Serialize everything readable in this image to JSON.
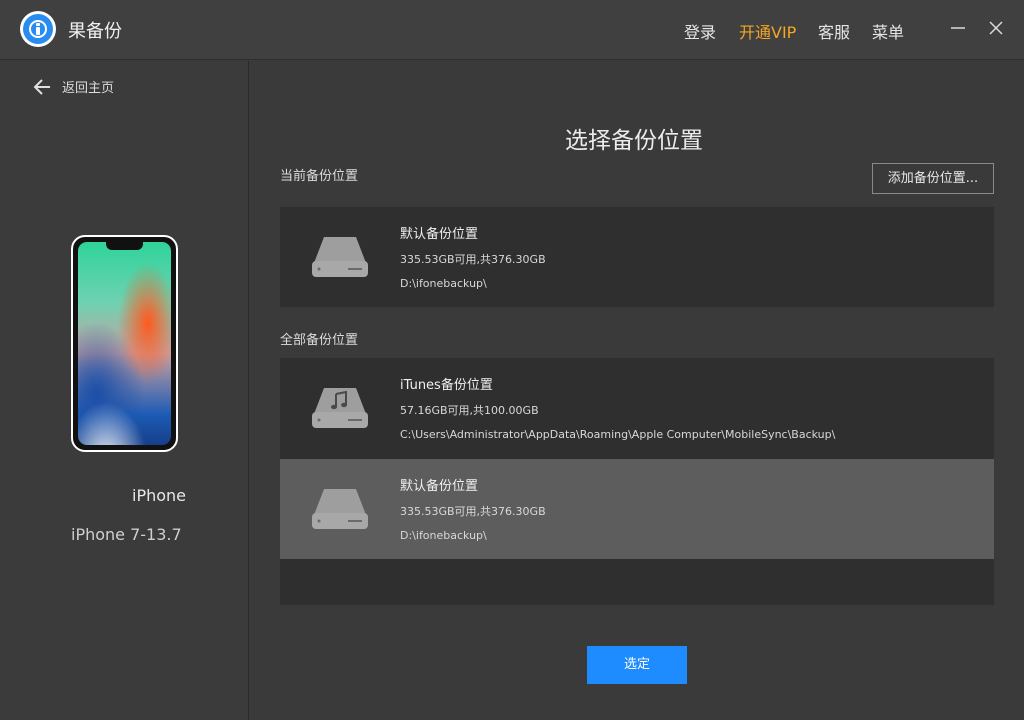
{
  "app": {
    "title": "果备份",
    "logo_icon": "info-refresh-icon"
  },
  "header": {
    "menu": [
      {
        "label": "登录"
      },
      {
        "label": "开通VIP",
        "color": "#f5a623"
      },
      {
        "label": "客服"
      },
      {
        "label": "菜单"
      }
    ],
    "minimize_icon": "minimize-icon",
    "close_icon": "close-icon"
  },
  "sidebar": {
    "back_label": "返回主页",
    "back_icon": "arrow-left-icon",
    "device_name": "iPhone",
    "device_model": "iPhone 7-13.7"
  },
  "main": {
    "title": "选择备份位置",
    "current_label": "当前备份位置",
    "add_button": "添加备份位置...",
    "current": {
      "name": "默认备份位置",
      "size": "335.53GB可用,共376.30GB",
      "path": "D:\\ifonebackup\\",
      "icon": "drive-icon"
    },
    "all_label": "全部备份位置",
    "all": [
      {
        "name": "iTunes备份位置",
        "size": "57.16GB可用,共100.00GB",
        "path": "C:\\Users\\Administrator\\AppData\\Roaming\\Apple Computer\\MobileSync\\Backup\\",
        "icon": "music-drive-icon",
        "selected": false
      },
      {
        "name": "默认备份位置",
        "size": "335.53GB可用,共376.30GB",
        "path": "D:\\ifonebackup\\",
        "icon": "drive-icon",
        "selected": true
      }
    ],
    "confirm_button": "选定"
  },
  "colors": {
    "accent": "#1e8bff",
    "vip": "#f5a623",
    "selected_row": "#5d5d5d"
  }
}
